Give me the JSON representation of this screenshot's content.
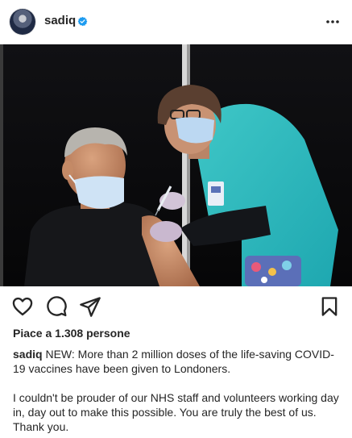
{
  "post": {
    "username": "sadiq",
    "likes_text": "Piace a 1.308 persone",
    "caption_username": "sadiq",
    "caption_line1": "NEW: More than 2 million doses of the life-saving COVID-19 vaccines have been given to Londoners.",
    "caption_para2": "I couldn't be prouder of our NHS staff and volunteers working day in, day out to make this possible. You are truly the best of us. Thank you."
  },
  "icons": {
    "verified": "verified-badge-icon",
    "more": "more-options-icon",
    "like": "heart-icon",
    "comment": "comment-icon",
    "share": "share-icon",
    "save": "bookmark-icon"
  },
  "colors": {
    "verified_blue": "#1d9bf0",
    "text": "#262626"
  }
}
